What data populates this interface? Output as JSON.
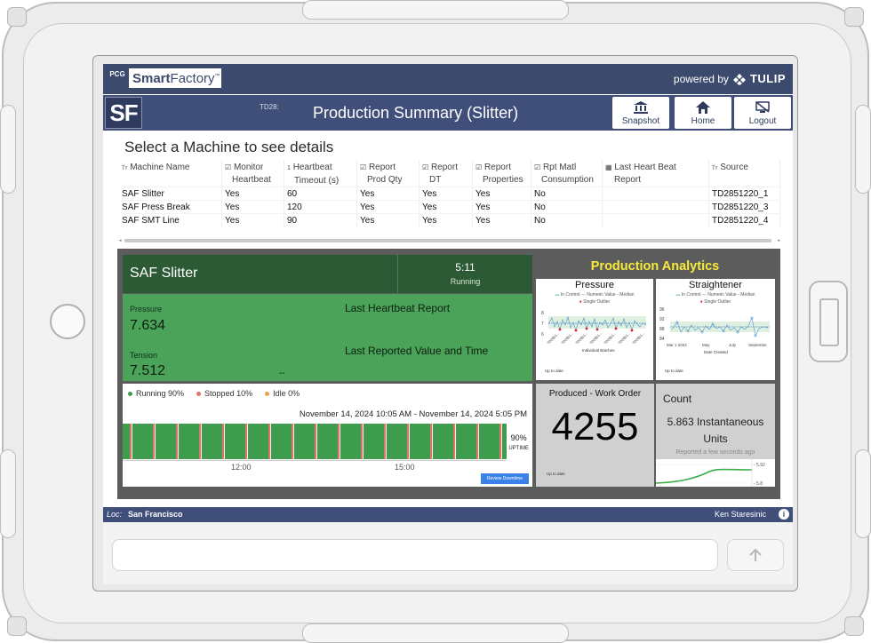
{
  "header": {
    "logo_prefix": "PCG",
    "logo_brand": "Smart",
    "logo_brand_rest": "Factory",
    "logo_tm": "™",
    "powered_by": "powered by",
    "tulip": "TULIP"
  },
  "titlebar": {
    "badge": "SF",
    "small_label": "TD28:",
    "title": "Production Summary (Slitter)",
    "buttons": [
      {
        "label": "Snapshot",
        "icon": "bank-icon"
      },
      {
        "label": "Home",
        "icon": "home-icon"
      },
      {
        "label": "Logout",
        "icon": "logout-icon"
      }
    ]
  },
  "machines": {
    "title": "Select a Machine to see details",
    "columns": [
      [
        "Machine Name",
        ""
      ],
      [
        "Monitor",
        "Heartbeat"
      ],
      [
        "Heartbeat",
        "Timeout (s)"
      ],
      [
        "Report",
        "Prod Qty"
      ],
      [
        "Report",
        "DT"
      ],
      [
        "Report",
        "Properties"
      ],
      [
        "Rpt Matl",
        "Consumption"
      ],
      [
        "Last Heart Beat",
        "Report"
      ],
      [
        "Source",
        ""
      ]
    ],
    "rows": [
      [
        "SAF Slitter",
        "Yes",
        "60",
        "Yes",
        "Yes",
        "Yes",
        "No",
        "",
        "TD2851220_1"
      ],
      [
        "SAF Press Break",
        "Yes",
        "120",
        "Yes",
        "Yes",
        "Yes",
        "No",
        "",
        "TD2851220_3"
      ],
      [
        "SAF SMT Line",
        "Yes",
        "90",
        "Yes",
        "Yes",
        "Yes",
        "No",
        "",
        "TD2851220_4"
      ]
    ]
  },
  "machine_detail": {
    "name": "SAF Slitter",
    "status_time": "5:11",
    "status": "Running",
    "pressure_label": "Pressure",
    "pressure_value": "7.634",
    "tension_label": "Tension",
    "tension_value": "7.512",
    "heartbeat_header": "Last Heartbeat Report",
    "reported_header": "Last Reported Value and Time",
    "reported_value": "--"
  },
  "uptime": {
    "legend": [
      {
        "label": "Running 90%",
        "color": "#3e9d4c"
      },
      {
        "label": "Stopped 10%",
        "color": "#e1726c"
      },
      {
        "label": "Idle 0%",
        "color": "#e6a54b"
      }
    ],
    "date_range": "November 14, 2024 10:05 AM - November 14, 2024 5:05 PM",
    "percent": "90%",
    "percent_label": "UPTIME",
    "ticks": [
      "12:00",
      "15:00"
    ],
    "review_button": "Review Downtime",
    "running_fraction": 0.9
  },
  "analytics": {
    "title": "Production Analytics",
    "pressure_chart": {
      "title": "Pressure",
      "legend": [
        "In Control",
        "Numeric Value - Median",
        "Single Outlier"
      ],
      "y_ticks": [
        "8",
        "7",
        "6"
      ],
      "x_label": "Individual Batches",
      "x_ticks": [
        "TD2851...",
        "TD2851...",
        "TD2851...",
        "TD2851...",
        "TD2851...",
        "TD2851...",
        "TD2851..."
      ],
      "footer": "Up to date"
    },
    "straightener_chart": {
      "title": "Straightener",
      "legend": [
        "In Control",
        "Numeric Value - Median",
        "Single Outlier"
      ],
      "y_ticks": [
        "96",
        "92",
        "88",
        "84"
      ],
      "x_ticks": [
        "Mar 1 2024",
        "May",
        "July",
        "Septembe"
      ],
      "x_label": "Date Created",
      "footer": "Up to date"
    },
    "produced": {
      "title": "Produced - Work Order",
      "value": "4255",
      "footer": "Up to date"
    },
    "count": {
      "title": "Count",
      "value_line1": "5.863 Instantaneous",
      "value_line2": "Units",
      "sub": "Reported a few seconds ago",
      "tick_top": "5.92",
      "tick_bottom": "5.8"
    }
  },
  "footer": {
    "loc_label": "Loc:",
    "location": "San Francisco",
    "user": "Ken Staresinic",
    "info": "i",
    "input_placeholder": ""
  }
}
